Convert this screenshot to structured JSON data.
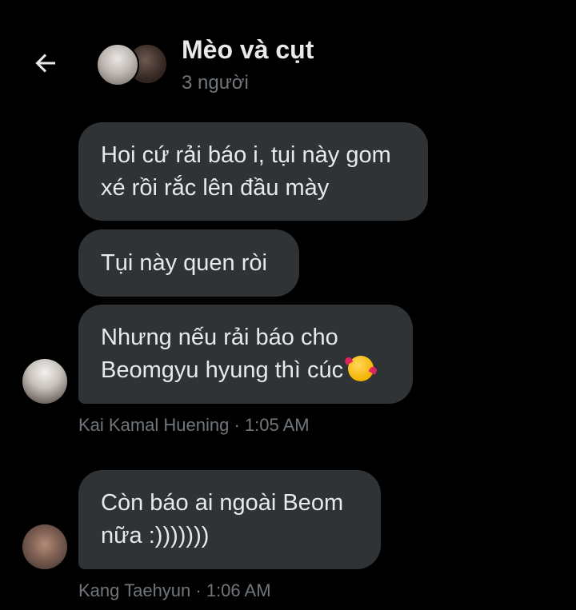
{
  "header": {
    "title": "Mèo và cụt",
    "subtitle": "3 người"
  },
  "messages": [
    {
      "lines": [
        "Hoi cứ rải báo i, tụi này gom",
        "xé rồi rắc lên đầu mày"
      ]
    },
    {
      "lines": [
        "Tụi này quen ròi"
      ]
    },
    {
      "lines": [
        "Nhưng nếu rải báo cho",
        "Beomgyu hyung thì cúc"
      ],
      "emoji": "smiling-face-with-hearts"
    },
    {
      "lines": [
        "Còn báo ai ngoài Beom",
        "nữa :)))))))"
      ]
    }
  ],
  "meta": [
    {
      "text": "Kai Kamal Huening · 1:05 AM"
    },
    {
      "text": "Kang Taehyun · 1:06 AM"
    }
  ],
  "icons": {
    "back": "arrow-left-icon"
  },
  "colors": {
    "background": "#000000",
    "bubble": "#2f3336",
    "text": "#e7e9ea",
    "secondary_text": "#71767b"
  }
}
